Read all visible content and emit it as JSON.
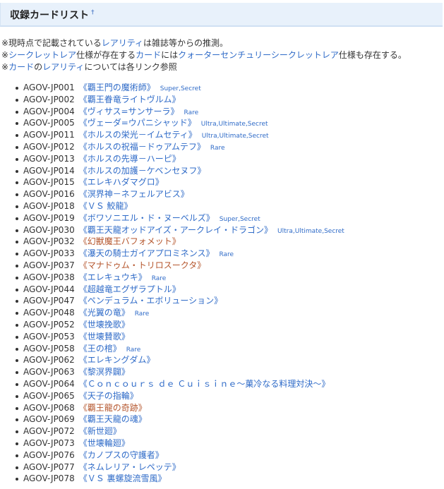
{
  "page": {
    "heading": "収録カードリスト",
    "heading_mark": "†"
  },
  "notes": [
    [
      {
        "text": "※現時点で記載されている",
        "link": false
      },
      {
        "text": "レアリティ",
        "link": true
      },
      {
        "text": "は雑誌等からの推測。",
        "link": false
      }
    ],
    [
      {
        "text": "※",
        "link": false
      },
      {
        "text": "シークレットレア",
        "link": true
      },
      {
        "text": "仕様が存在する",
        "link": false
      },
      {
        "text": "カード",
        "link": true
      },
      {
        "text": "には",
        "link": false
      },
      {
        "text": "クォーターセンチュリーシークレットレア",
        "link": true
      },
      {
        "text": "仕様も存在する。",
        "link": false
      }
    ],
    [
      {
        "text": "※",
        "link": false
      },
      {
        "text": "カード",
        "link": true
      },
      {
        "text": "の",
        "link": false
      },
      {
        "text": "レアリティ",
        "link": true
      },
      {
        "text": "については各リンク参照",
        "link": false
      }
    ]
  ],
  "colors": {
    "link": "#2f6bc8",
    "new_page_link": "#b5562d",
    "header_bg": "#e8f1fb"
  },
  "cards": [
    {
      "code": "AGOV-JP001",
      "name": "《覇王門の魔術師》",
      "rarity": "Super,Secret",
      "style": "link"
    },
    {
      "code": "AGOV-JP002",
      "name": "《覇王眷竜ライトヴルム》",
      "rarity": "",
      "style": "link"
    },
    {
      "code": "AGOV-JP004",
      "name": "《ヴィサス=サンサーラ》",
      "rarity": "Rare",
      "style": "link"
    },
    {
      "code": "AGOV-JP005",
      "name": "《ヴェーダ=ウパニシャッド》",
      "rarity": "Ultra,Ultimate,Secret",
      "style": "link"
    },
    {
      "code": "AGOV-JP011",
      "name": "《ホルスの栄光－イムセティ》",
      "rarity": "Ultra,Ultimate,Secret",
      "style": "link"
    },
    {
      "code": "AGOV-JP012",
      "name": "《ホルスの祝福－ドゥアムテフ》",
      "rarity": "Rare",
      "style": "link"
    },
    {
      "code": "AGOV-JP013",
      "name": "《ホルスの先導－ハーピ》",
      "rarity": "",
      "style": "link"
    },
    {
      "code": "AGOV-JP014",
      "name": "《ホルスの加護－ケベンセヌフ》",
      "rarity": "",
      "style": "link"
    },
    {
      "code": "AGOV-JP015",
      "name": "《エレキハダマグロ》",
      "rarity": "",
      "style": "link"
    },
    {
      "code": "AGOV-JP016",
      "name": "《溟界神－ネフェルアビス》",
      "rarity": "",
      "style": "link"
    },
    {
      "code": "AGOV-JP018",
      "name": "《ＶＳ 鮫龍》",
      "rarity": "",
      "style": "link"
    },
    {
      "code": "AGOV-JP019",
      "name": "《ボワソニエル・ド・ヌーベルズ》",
      "rarity": "Super,Secret",
      "style": "link"
    },
    {
      "code": "AGOV-JP030",
      "name": "《覇王天龍オッドアイズ・アークレイ・ドラゴン》",
      "rarity": "Ultra,Ultimate,Secret",
      "style": "link"
    },
    {
      "code": "AGOV-JP032",
      "name": "《幻獣魔王バフォメット》",
      "rarity": "",
      "style": "new"
    },
    {
      "code": "AGOV-JP033",
      "name": "《瀑天の騎士ガイアプロミネンス》",
      "rarity": "Rare",
      "style": "link"
    },
    {
      "code": "AGOV-JP037",
      "name": "《マナドゥム・トリロスークタ》",
      "rarity": "",
      "style": "new"
    },
    {
      "code": "AGOV-JP038",
      "name": "《エレキュウキ》",
      "rarity": "Rare",
      "style": "link"
    },
    {
      "code": "AGOV-JP044",
      "name": "《超越竜エグザラプトル》",
      "rarity": "",
      "style": "link"
    },
    {
      "code": "AGOV-JP047",
      "name": "《ペンデュラム・エボリューション》",
      "rarity": "",
      "style": "link"
    },
    {
      "code": "AGOV-JP048",
      "name": "《光翼の竜》",
      "rarity": "Rare",
      "style": "link"
    },
    {
      "code": "AGOV-JP052",
      "name": "《世壊挽歌》",
      "rarity": "",
      "style": "link"
    },
    {
      "code": "AGOV-JP053",
      "name": "《世壊賛歌》",
      "rarity": "",
      "style": "link"
    },
    {
      "code": "AGOV-JP058",
      "name": "《王の棺》",
      "rarity": "Rare",
      "style": "link"
    },
    {
      "code": "AGOV-JP062",
      "name": "《エレキングダム》",
      "rarity": "",
      "style": "link"
    },
    {
      "code": "AGOV-JP063",
      "name": "《黎溟界闢》",
      "rarity": "",
      "style": "link"
    },
    {
      "code": "AGOV-JP064",
      "name": "《Ｃｏｎｃｏｕｒｓ ｄｅ Ｃｕｉｓｉｎｅ～菓冷なる料理対決～》",
      "rarity": "",
      "style": "link"
    },
    {
      "code": "AGOV-JP065",
      "name": "《天子の指輪》",
      "rarity": "",
      "style": "link"
    },
    {
      "code": "AGOV-JP068",
      "name": "《覇王龍の奇跡》",
      "rarity": "",
      "style": "new"
    },
    {
      "code": "AGOV-JP069",
      "name": "《覇王天龍の魂》",
      "rarity": "",
      "style": "link"
    },
    {
      "code": "AGOV-JP072",
      "name": "《新世廻》",
      "rarity": "",
      "style": "link"
    },
    {
      "code": "AGOV-JP073",
      "name": "《世壊輪廻》",
      "rarity": "",
      "style": "link"
    },
    {
      "code": "AGOV-JP076",
      "name": "《カノプスの守護者》",
      "rarity": "",
      "style": "link"
    },
    {
      "code": "AGOV-JP077",
      "name": "《ネムレリア・レペッテ》",
      "rarity": "",
      "style": "link"
    },
    {
      "code": "AGOV-JP078",
      "name": "《ＶＳ 裏螺旋流雪風》",
      "rarity": "",
      "style": "link"
    }
  ]
}
